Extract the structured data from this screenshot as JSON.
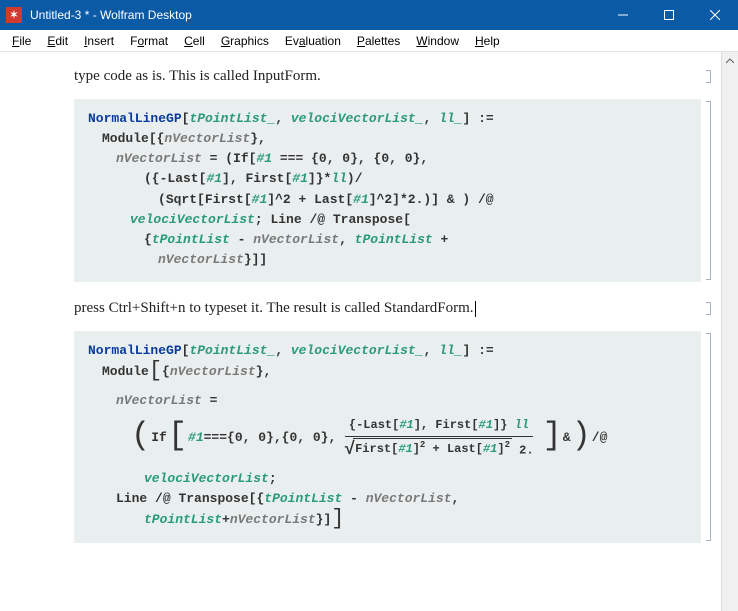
{
  "window": {
    "title": "Untitled-3 * - Wolfram Desktop",
    "app_icon_char": "✶"
  },
  "menu": {
    "items": [
      {
        "u": "F",
        "rest": "ile"
      },
      {
        "u": "E",
        "rest": "dit"
      },
      {
        "u": "I",
        "rest": "nsert"
      },
      {
        "u": "",
        "rest": "F",
        "u2": "o",
        "rest2": "rmat"
      },
      {
        "u": "C",
        "rest": "ell"
      },
      {
        "u": "G",
        "rest": "raphics"
      },
      {
        "u": "",
        "rest": "Ev",
        "u2": "a",
        "rest2": "luation"
      },
      {
        "u": "P",
        "rest": "alettes"
      },
      {
        "u": "W",
        "rest": "indow"
      },
      {
        "u": "H",
        "rest": "elp"
      }
    ]
  },
  "text1": "type code as is. This is called InputForm.",
  "text2": "press Ctrl+Shift+n to typeset it. The result is called StandardForm.",
  "code1": {
    "l1_fn": "NormalLineGP",
    "l1_a1": "tPointList_",
    "l1_a2": "velociVectorList_",
    "l1_a3": "ll_",
    "l1_end": " :=",
    "l2_mod": "Module",
    "l2_loc": "nVectorList",
    "l3_eqL": "nVectorList",
    "l3_if1": "If",
    "l3_slot": "#1",
    "l3_eq": " === ",
    "l3_set1": "{0, 0}",
    "l3_set2": "{0, 0}",
    "l4_lb": "({-",
    "l4_last": "Last",
    "l4_first": "First",
    "l4_slot": "#1",
    "l4_mul": "}*",
    "l4_ll": "ll",
    "l5_sqrt": "Sqrt",
    "l5_first": "First",
    "l5_last": "Last",
    "l5_slot": "#1",
    "l5_exp": "^2",
    "l5_two": "*2.",
    "l5_end": ")] & ) /@",
    "l6_vvl": "velociVectorList",
    "l6_line": "Line",
    "l6_map": " /@ ",
    "l6_tr": "Transpose",
    "l7_tpl": "tPointList",
    "l7_nvl": "nVectorList",
    "l8_nvl": "nVectorList"
  },
  "code2": {
    "l1_fn": "NormalLineGP",
    "l1_a1": "tPointList_",
    "l1_a2": "velociVectorList_",
    "l1_a3": "ll_",
    "l1_end": " :=",
    "l2_mod": "Module",
    "l2_loc": "nVectorList",
    "l3_nvl": "nVectorList",
    "if": "If",
    "slot": "#1",
    "eqeq": " === ",
    "set": "{0, 0}",
    "last": "Last",
    "first": "First",
    "ll": "ll",
    "two": " 2.",
    "amp_map": " & ",
    "map_at": " /@",
    "vvl": "velociVectorList",
    "line": "Line",
    "transpose": "Transpose",
    "tpl": "tPointList",
    "nvl": "nVectorList"
  }
}
